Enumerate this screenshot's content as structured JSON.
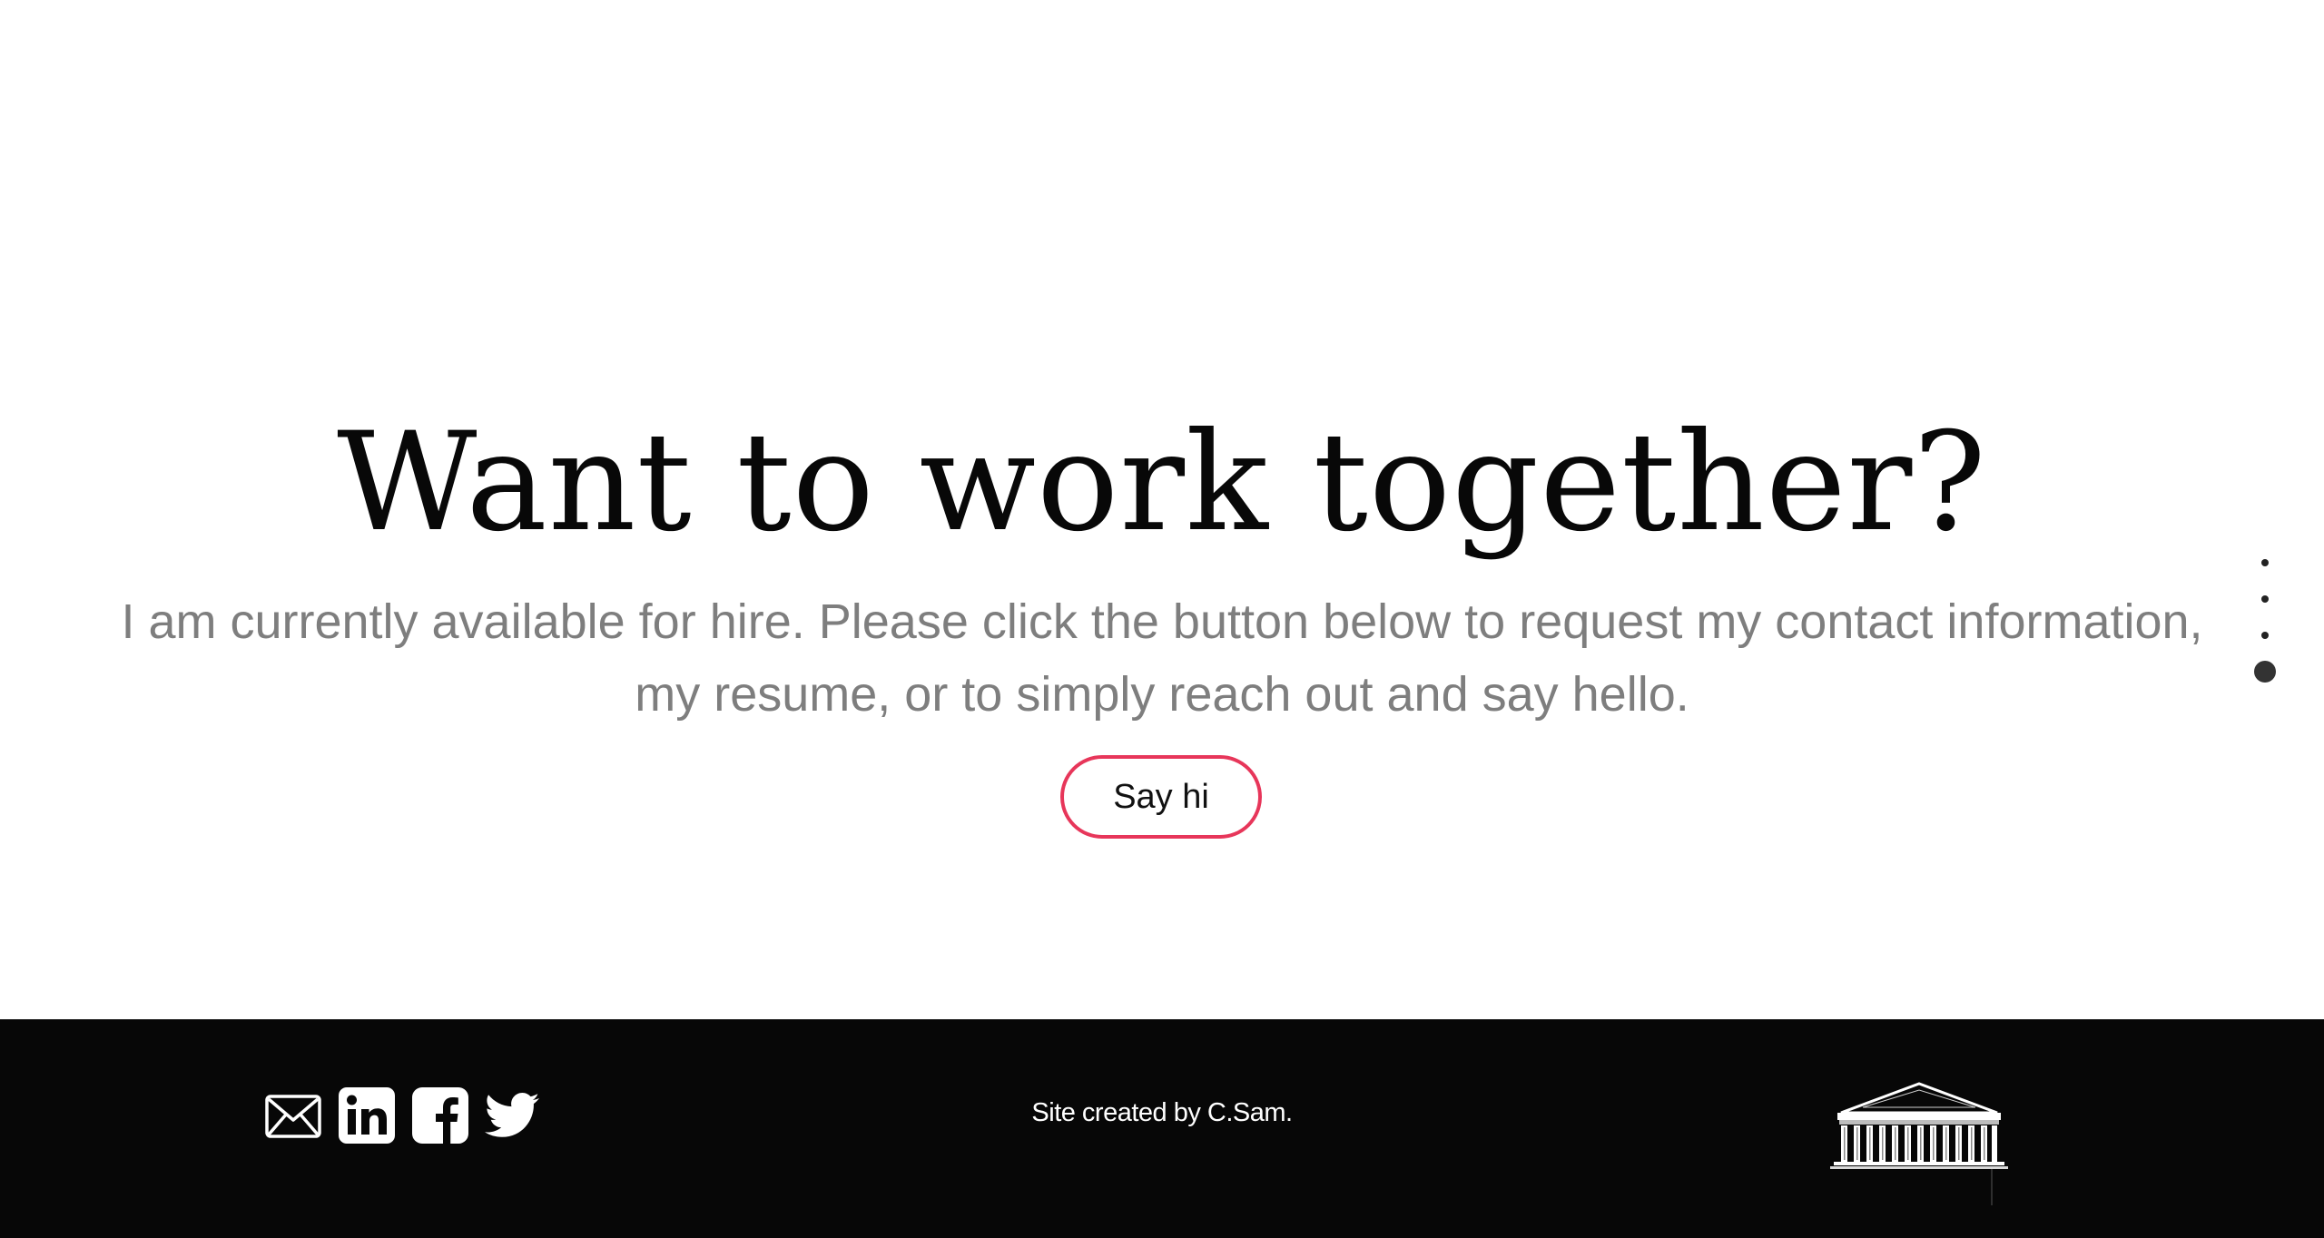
{
  "hero": {
    "title": "Want to work together?",
    "line1": "I am currently available for hire. Please click the button below to request my contact information,",
    "line2": "my resume, or to simply reach out and say hello.",
    "button_label": "Say hi",
    "button_border_color": "#e7365a"
  },
  "page_nav": {
    "dots": 4,
    "active_index": 3
  },
  "footer": {
    "credit": "Site created by C.Sam.",
    "social_icons": [
      "mail-icon",
      "linkedin-icon",
      "facebook-icon",
      "twitter-icon"
    ],
    "logo": "parthenon-logo"
  },
  "colors": {
    "footer_bg": "#070707",
    "subtext": "#7e7e7e",
    "accent": "#e7365a"
  }
}
